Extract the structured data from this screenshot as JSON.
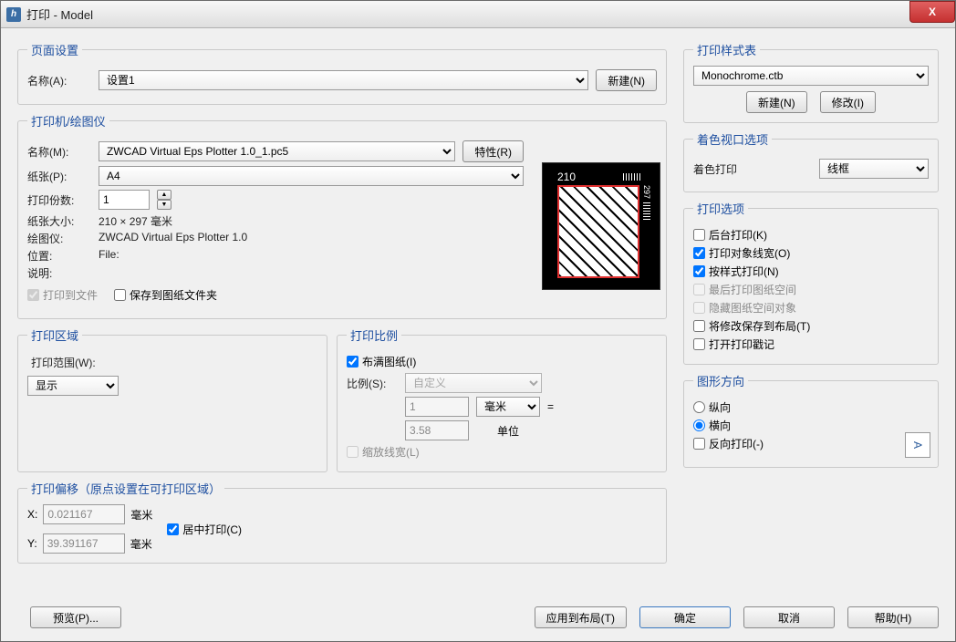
{
  "window": {
    "title": "打印 - Model",
    "close": "X"
  },
  "page_setup": {
    "legend": "页面设置",
    "name_label": "名称(A):",
    "name_value": "设置1",
    "new_btn": "新建(N)"
  },
  "plotter": {
    "legend": "打印机/绘图仪",
    "name_label": "名称(M):",
    "name_value": "ZWCAD Virtual Eps Plotter 1.0_1.pc5",
    "props_btn": "特性(R)",
    "paper_label": "纸张(P):",
    "paper_value": "A4",
    "copies_label": "打印份数:",
    "copies_value": "1",
    "size_label": "纸张大小:",
    "size_value": "210 × 297  毫米",
    "plotter_label": "绘图仪:",
    "plotter_value": "ZWCAD Virtual Eps Plotter 1.0",
    "location_label": "位置:",
    "location_value": "File:",
    "desc_label": "说明:",
    "to_file": "打印到文件",
    "save_to_folder": "保存到图纸文件夹",
    "preview_w": "210",
    "preview_h": "297"
  },
  "area": {
    "legend": "打印区域",
    "range_label": "打印范围(W):",
    "range_value": "显示"
  },
  "scale": {
    "legend": "打印比例",
    "fit": "布满图纸(I)",
    "ratio_label": "比例(S):",
    "ratio_value": "自定义",
    "num": "1",
    "unit_sel": "毫米",
    "eq": "=",
    "den": "3.58",
    "unit_lbl": "单位",
    "scale_lw": "缩放线宽(L)"
  },
  "offset": {
    "legend": "打印偏移（原点设置在可打印区域）",
    "x_label": "X:",
    "x_value": "0.021167",
    "y_label": "Y:",
    "y_value": "39.391167",
    "unit": "毫米",
    "center": "居中打印(C)"
  },
  "style": {
    "legend": "打印样式表",
    "value": "Monochrome.ctb",
    "new_btn": "新建(N)",
    "edit_btn": "修改(I)"
  },
  "shade": {
    "legend": "着色视口选项",
    "label": "着色打印",
    "value": "线框"
  },
  "options": {
    "legend": "打印选项",
    "bg": "后台打印(K)",
    "lw": "打印对象线宽(O)",
    "style": "按样式打印(N)",
    "paperspace_last": "最后打印图纸空间",
    "hide_ps": "隐藏图纸空间对象",
    "save_layout": "将修改保存到布局(T)",
    "stamp": "打开打印戳记"
  },
  "orient": {
    "legend": "图形方向",
    "portrait": "纵向",
    "landscape": "横向",
    "upside": "反向打印(-)",
    "icon": "A"
  },
  "footer": {
    "preview": "预览(P)...",
    "apply": "应用到布局(T)",
    "ok": "确定",
    "cancel": "取消",
    "help": "帮助(H)"
  }
}
